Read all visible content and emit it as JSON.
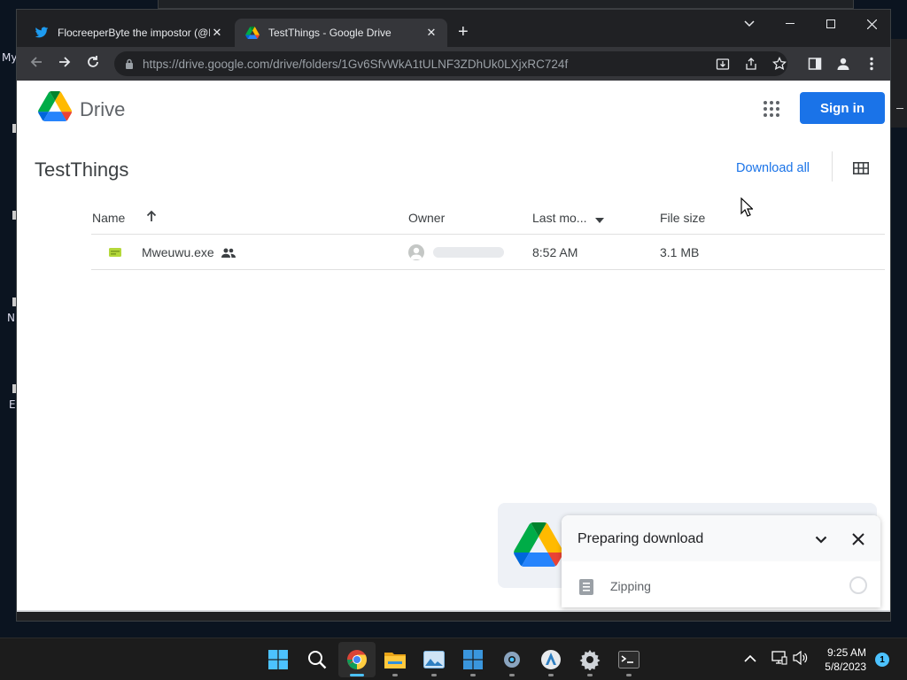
{
  "desktop": {
    "icon_labels": [
      "My",
      "N",
      "E"
    ]
  },
  "browser": {
    "tabs": [
      {
        "title": "FlocreeperByte the impostor (@F",
        "icon": "twitter-icon",
        "active": false
      },
      {
        "title": "TestThings - Google Drive",
        "icon": "google-drive-icon",
        "active": true
      }
    ],
    "new_tab": "+",
    "url_host": "https://drive.google.com",
    "url_path": "/drive/folders/1Gv6SfvWkA1tULNF3ZDhUk0LXjxRC724f",
    "colors": {
      "frame": "#202124",
      "toolbar": "#35363a",
      "accent": "#1a73e8"
    }
  },
  "drive": {
    "brand": "Drive",
    "sign_in": "Sign in",
    "folder_title": "TestThings",
    "download_all": "Download all",
    "columns": {
      "name": "Name",
      "owner": "Owner",
      "last_modified": "Last mo...",
      "file_size": "File size"
    },
    "files": [
      {
        "name": "Mweuwu.exe",
        "shared": true,
        "last_modified": "8:52 AM",
        "file_size": "3.1 MB"
      }
    ]
  },
  "download_toast": {
    "title": "Preparing download",
    "item_label": "Zipping"
  },
  "taskbar": {
    "apps": [
      "start-icon",
      "search-icon",
      "chrome-icon",
      "file-explorer-icon",
      "photos-icon",
      "store-icon",
      "settings-gear-icon",
      "app-icon",
      "settings-icon",
      "terminal-icon"
    ],
    "time": "9:25 AM",
    "date": "5/8/2023",
    "notifications": "1"
  }
}
